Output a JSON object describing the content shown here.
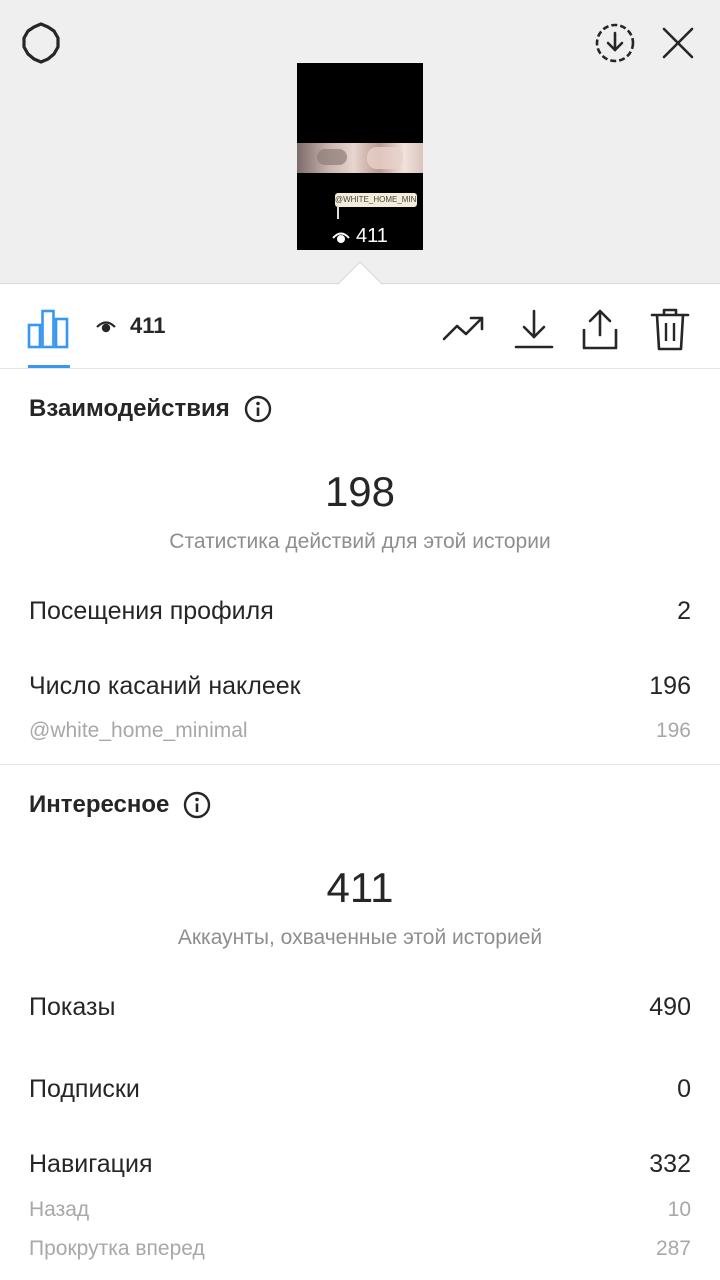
{
  "header": {
    "settings_icon": "gear-icon",
    "save_icon": "download-circle-icon",
    "close_icon": "close-icon"
  },
  "story_preview": {
    "sticker_text": "@WHITE_HOME_MINIMAL",
    "views": "411"
  },
  "toolbar": {
    "views": "411",
    "icons": [
      "bar-chart-icon",
      "eye-icon",
      "promote-icon",
      "download-icon",
      "share-icon",
      "trash-icon"
    ]
  },
  "interactions": {
    "title": "Взаимодействия",
    "total": "198",
    "caption": "Статистика действий для этой истории",
    "rows": [
      {
        "label": "Посещения профиля",
        "value": "2"
      },
      {
        "label": "Число касаний наклеек",
        "value": "196"
      }
    ],
    "sub_rows": [
      {
        "label": "@white_home_minimal",
        "value": "196"
      }
    ]
  },
  "discovery": {
    "title": "Интересное",
    "total": "411",
    "caption": "Аккаунты, охваченные этой историей",
    "rows": [
      {
        "label": "Показы",
        "value": "490"
      },
      {
        "label": "Подписки",
        "value": "0"
      },
      {
        "label": "Навигация",
        "value": "332"
      }
    ],
    "sub_rows": [
      {
        "label": "Назад",
        "value": "10"
      },
      {
        "label": "Прокрутка вперед",
        "value": "287"
      }
    ]
  },
  "colors": {
    "accent": "#3897f0",
    "text": "#262626",
    "secondary": "#8e8e8e",
    "preview_bg": "#efefef"
  }
}
